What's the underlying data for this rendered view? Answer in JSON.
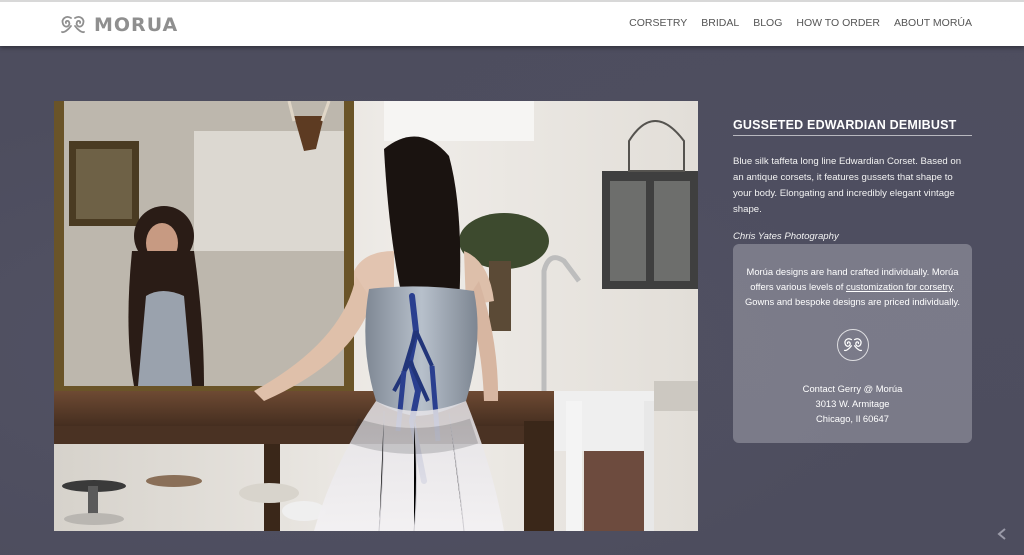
{
  "brand": {
    "name": "MORUA",
    "logo_icon": "scroll-ornament-icon"
  },
  "nav": [
    {
      "label": "CORSETRY"
    },
    {
      "label": "BRIDAL"
    },
    {
      "label": "BLOG"
    },
    {
      "label": "HOW TO ORDER"
    },
    {
      "label": "ABOUT MORÚA"
    }
  ],
  "product": {
    "title": "GUSSETED EDWARDIAN DEMIBUST",
    "description": "Blue silk taffeta long line Edwardian Corset. Based on an antique corsets, it features gussets that shape to your body. Elongating and incredibly elegant vintage shape.",
    "credit": "Chris Yates Photography"
  },
  "card": {
    "line_1": "Morúa designs are hand crafted individually. Morúa offers various levels of ",
    "link": "customization for corsetry",
    "line_2": ". Gowns and bespoke designs are priced individually.",
    "emblem_icon": "scroll-ornament-icon",
    "contact_name": "Contact Gerry @ Morúa",
    "address_1": "3013 W. Armitage",
    "address_2": "Chicago, Il 60647"
  },
  "colors": {
    "header_bg": "#ffffff",
    "page_bg": "#4d4d5e",
    "card_bg": "#a0a0ac",
    "corset_ribbon": "#2a3f8f"
  }
}
